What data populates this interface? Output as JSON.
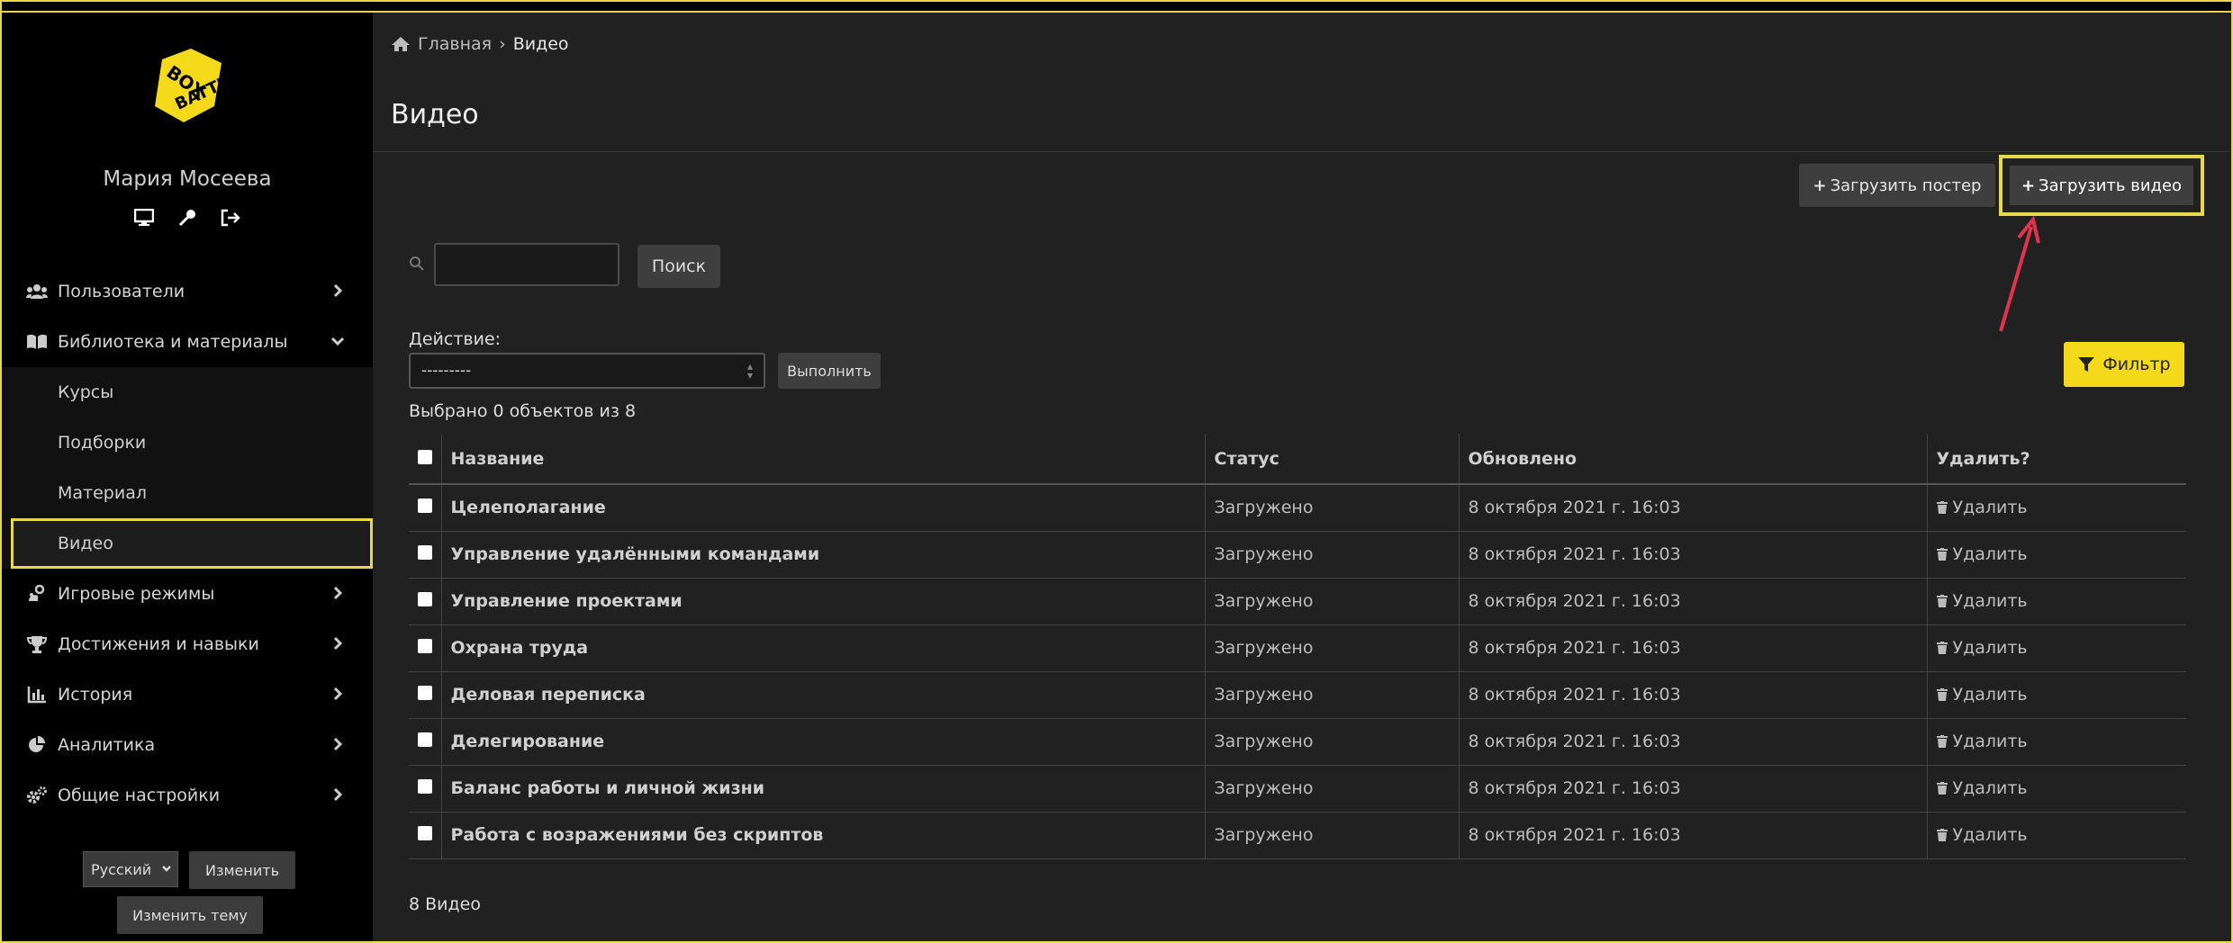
{
  "sidebar": {
    "logo_text": "BOXBATTLE",
    "user_name": "Мария Мосеева",
    "nav": [
      {
        "label": "Пользователи",
        "icon": "users-icon"
      },
      {
        "label": "Библиотека и материалы",
        "icon": "book-icon"
      }
    ],
    "sub": [
      {
        "label": "Курсы"
      },
      {
        "label": "Подборки"
      },
      {
        "label": "Материал"
      },
      {
        "label": "Видео"
      }
    ],
    "nav2": [
      {
        "label": "Игровые режимы",
        "icon": "gamepad-icon"
      },
      {
        "label": "Достижения и навыки",
        "icon": "trophy-icon"
      },
      {
        "label": "История",
        "icon": "chart-icon"
      },
      {
        "label": "Аналитика",
        "icon": "pie-icon"
      },
      {
        "label": "Общие настройки",
        "icon": "cogs-icon"
      }
    ],
    "language": "Русский",
    "change_btn": "Изменить",
    "change_theme_btn": "Изменить тему"
  },
  "breadcrumb": {
    "home": "Главная",
    "sep": "›",
    "current": "Видео"
  },
  "page_title": "Видео",
  "buttons": {
    "upload_poster": "Загрузить постер",
    "upload_video": "Загрузить видео",
    "search": "Поиск",
    "run": "Выполнить",
    "filter": "Фильтр"
  },
  "action": {
    "label": "Действие:",
    "value": "---------"
  },
  "selected_text": "Выбрано 0 объектов из 8",
  "table": {
    "headers": {
      "name": "Название",
      "status": "Статус",
      "updated": "Обновлено",
      "delete": "Удалить?"
    },
    "delete_label": "Удалить",
    "rows": [
      {
        "name": "Целеполагание",
        "status": "Загружено",
        "updated": "8 октября 2021 г. 16:03"
      },
      {
        "name": "Управление удалёнными командами",
        "status": "Загружено",
        "updated": "8 октября 2021 г. 16:03"
      },
      {
        "name": "Управление проектами",
        "status": "Загружено",
        "updated": "8 октября 2021 г. 16:03"
      },
      {
        "name": "Охрана труда",
        "status": "Загружено",
        "updated": "8 октября 2021 г. 16:03"
      },
      {
        "name": "Деловая переписка",
        "status": "Загружено",
        "updated": "8 октября 2021 г. 16:03"
      },
      {
        "name": "Делегирование",
        "status": "Загружено",
        "updated": "8 октября 2021 г. 16:03"
      },
      {
        "name": "Баланс работы и личной жизни",
        "status": "Загружено",
        "updated": "8 октября 2021 г. 16:03"
      },
      {
        "name": "Работа с возражениями без скриптов",
        "status": "Загружено",
        "updated": "8 октября 2021 г. 16:03"
      }
    ]
  },
  "footer_count": "8 Видео",
  "colors": {
    "accent": "#f5d91b",
    "frame": "#e8d84e",
    "arrow": "#e0344a"
  }
}
